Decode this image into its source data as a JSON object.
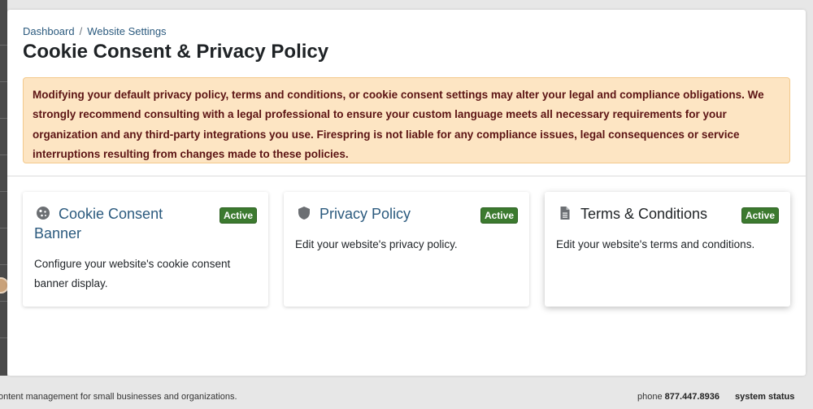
{
  "breadcrumb": {
    "items": [
      "Dashboard",
      "Website Settings"
    ],
    "separator": "/"
  },
  "page": {
    "title": "Cookie Consent & Privacy Policy"
  },
  "warning": {
    "text": "Modifying your default privacy policy, terms and conditions, or cookie consent settings may alter your legal and compliance obligations. We strongly recommend consulting with a legal professional to ensure your custom language meets all necessary requirements for your organization and any third-party integrations you use. Firespring is not liable for any compliance issues, legal consequences or service interruptions resulting from changes made to these policies."
  },
  "cards": [
    {
      "icon": "cookie-icon",
      "title": "Cookie Consent Banner",
      "badge": "Active",
      "description": "Configure your website's cookie consent banner display."
    },
    {
      "icon": "shield-icon",
      "title": "Privacy Policy",
      "badge": "Active",
      "description": "Edit your website's privacy policy."
    },
    {
      "icon": "document-icon",
      "title": "Terms & Conditions",
      "badge": "Active",
      "description": "Edit your website's terms and conditions."
    }
  ],
  "footer": {
    "tagline": "ontent management for small businesses and organizations.",
    "phone_label": "phone",
    "phone_number": "877.447.8936",
    "system_status": "system status"
  },
  "colors": {
    "link": "#2b5a7e",
    "badge": "#3c7a2f",
    "warning_bg": "#fde5c3",
    "warning_text": "#5c1414"
  }
}
